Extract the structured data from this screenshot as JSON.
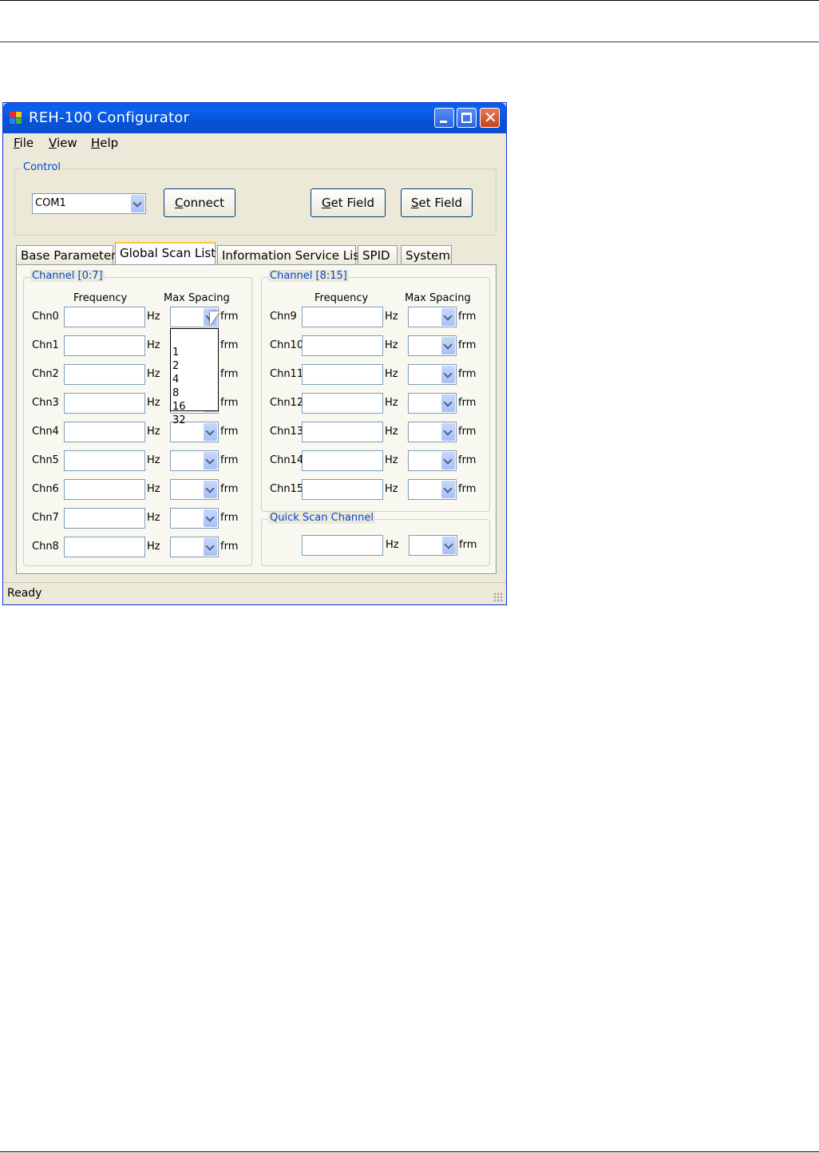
{
  "window": {
    "title": "REH-100 Configurator"
  },
  "menu": [
    {
      "label": "File",
      "accel": "F",
      "rest": "ile"
    },
    {
      "label": "View",
      "accel": "V",
      "rest": "iew"
    },
    {
      "label": "Help",
      "accel": "H",
      "rest": "elp"
    }
  ],
  "control": {
    "legend": "Control",
    "port_value": "COM1",
    "connect_accel": "C",
    "connect_rest": "onnect",
    "get_accel": "G",
    "get_rest": "et Field",
    "set_accel": "S",
    "set_rest": "et Field"
  },
  "tabs": [
    "Base Parameter",
    "Global Scan List",
    "Information Service List",
    "SPID",
    "System"
  ],
  "active_tab": "Global Scan List",
  "left_group": {
    "legend": "Channel [0:7]",
    "freq_header": "Frequency",
    "spacing_header": "Max Spacing",
    "channels": [
      "Chn0",
      "Chn1",
      "Chn2",
      "Chn3",
      "Chn4",
      "Chn5",
      "Chn6",
      "Chn7",
      "Chn8"
    ]
  },
  "right_group": {
    "legend": "Channel [8:15]",
    "freq_header": "Frequency",
    "spacing_header": "Max Spacing",
    "channels": [
      "Chn9",
      "Chn10",
      "Chn11",
      "Chn12",
      "Chn13",
      "Chn14",
      "Chn15"
    ]
  },
  "quick_scan": {
    "legend": "Quick Scan Channel"
  },
  "units": {
    "hz": "Hz",
    "frm": "frm"
  },
  "dropdown_options": [
    "1",
    "2",
    "4",
    "8",
    "16",
    "32"
  ],
  "status": "Ready"
}
